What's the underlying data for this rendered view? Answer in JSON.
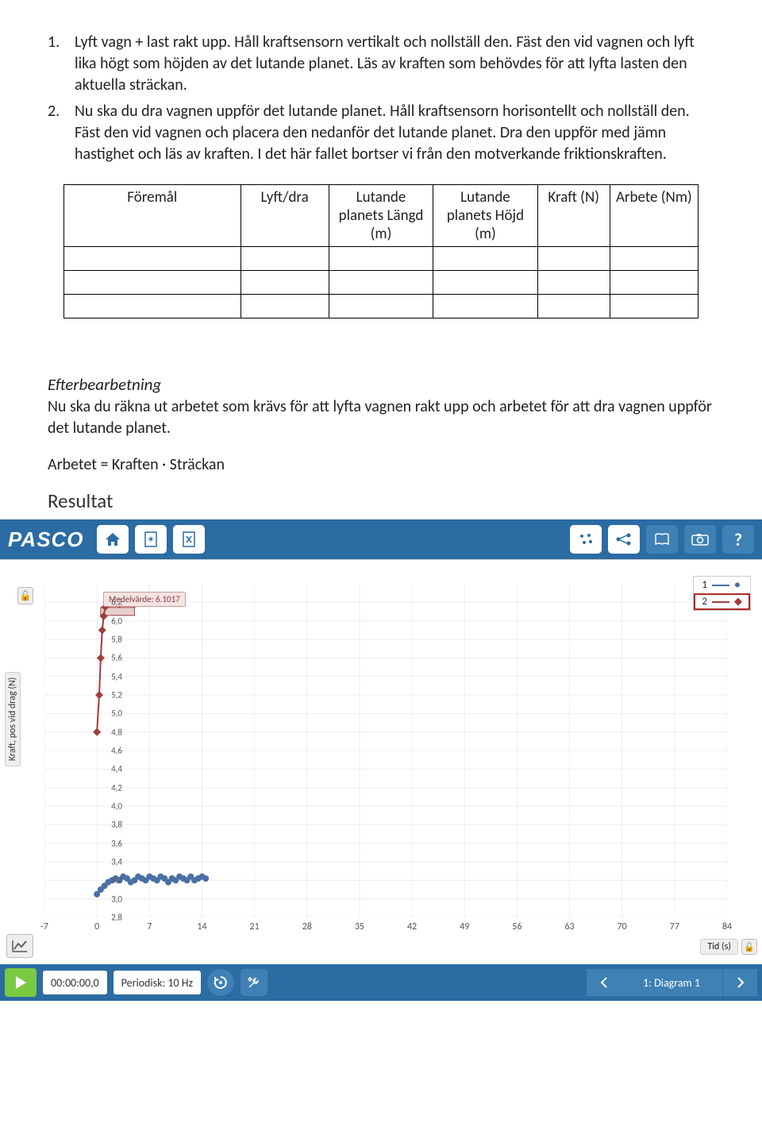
{
  "instructions": [
    {
      "num": "1.",
      "text": "Lyft vagn + last rakt upp. Håll kraftsensorn vertikalt och nollställ den. Fäst den vid vagnen och lyft lika högt som höjden av det lutande planet. Läs av kraften som behövdes för att lyfta lasten den aktuella sträckan."
    },
    {
      "num": "2.",
      "text": "Nu ska du dra vagnen uppför det lutande planet. Håll kraftsensorn horisontellt och nollställ den. Fäst den vid vagnen och placera den nedanför det lutande planet. Dra den uppför med jämn hastighet och läs av kraften. I det här fallet bortser vi från den motverkande friktionskraften."
    }
  ],
  "table": {
    "headers": [
      "Föremål",
      "Lyft/dra",
      "Lutande planets Längd (m)",
      "Lutande planets Höjd (m)",
      "Kraft (N)",
      "Arbete (Nm)"
    ],
    "rows": 3
  },
  "post": {
    "heading": "Efterbearbetning",
    "text": "Nu ska du räkna ut arbetet som krävs för att lyfta vagnen rakt upp och arbetet för att dra vagnen uppför det lutande planet.",
    "formula": "Arbetet = Kraften · Sträckan",
    "result_heading": "Resultat"
  },
  "pasco": {
    "logo": "PASCO",
    "legend": [
      "1",
      "2"
    ],
    "annotation": "Medelvärde: 6.1017",
    "ylabel": "Kraft, pos vid drag (N)",
    "xlabel": "Tid (s)",
    "yticks": [
      "6,2",
      "6,0",
      "5,8",
      "5,6",
      "5,4",
      "5,2",
      "5,0",
      "4,8",
      "4,6",
      "4,4",
      "4,2",
      "4,0",
      "3,8",
      "3,6",
      "3,4",
      "3,2",
      "3,0",
      "2,8"
    ],
    "xticks": [
      "-7",
      "0",
      "7",
      "14",
      "21",
      "28",
      "35",
      "42",
      "49",
      "56",
      "63",
      "70",
      "77",
      "84"
    ],
    "bottom": {
      "time": "00:00:00,0",
      "rate": "Periodisk: 10 Hz",
      "page": "1: Diagram 1"
    }
  },
  "chart_data": {
    "type": "scatter",
    "xlabel": "Tid (s)",
    "ylabel": "Kraft, pos vid drag (N)",
    "xlim": [
      -7,
      84
    ],
    "ylim": [
      2.8,
      6.4
    ],
    "series": [
      {
        "name": "1",
        "color": "#4a6fa5",
        "points": [
          {
            "x": 0.0,
            "y": 3.05
          },
          {
            "x": 0.5,
            "y": 3.1
          },
          {
            "x": 1.0,
            "y": 3.14
          },
          {
            "x": 1.5,
            "y": 3.18
          },
          {
            "x": 2.0,
            "y": 3.2
          },
          {
            "x": 2.5,
            "y": 3.22
          },
          {
            "x": 3.0,
            "y": 3.2
          },
          {
            "x": 3.5,
            "y": 3.24
          },
          {
            "x": 4.0,
            "y": 3.22
          },
          {
            "x": 4.5,
            "y": 3.18
          },
          {
            "x": 5.0,
            "y": 3.2
          },
          {
            "x": 5.5,
            "y": 3.24
          },
          {
            "x": 6.0,
            "y": 3.22
          },
          {
            "x": 6.5,
            "y": 3.2
          },
          {
            "x": 7.0,
            "y": 3.24
          },
          {
            "x": 7.5,
            "y": 3.22
          },
          {
            "x": 8.0,
            "y": 3.2
          },
          {
            "x": 8.5,
            "y": 3.24
          },
          {
            "x": 9.0,
            "y": 3.22
          },
          {
            "x": 9.5,
            "y": 3.18
          },
          {
            "x": 10.0,
            "y": 3.22
          },
          {
            "x": 10.5,
            "y": 3.2
          },
          {
            "x": 11.0,
            "y": 3.24
          },
          {
            "x": 11.5,
            "y": 3.22
          },
          {
            "x": 12.0,
            "y": 3.2
          },
          {
            "x": 12.5,
            "y": 3.24
          },
          {
            "x": 13.0,
            "y": 3.2
          },
          {
            "x": 13.5,
            "y": 3.22
          },
          {
            "x": 14.0,
            "y": 3.24
          },
          {
            "x": 14.5,
            "y": 3.22
          }
        ]
      },
      {
        "name": "2",
        "color": "#a23b3b",
        "mean": 6.1017,
        "points": [
          {
            "x": 0.0,
            "y": 4.8
          },
          {
            "x": 0.3,
            "y": 5.2
          },
          {
            "x": 0.5,
            "y": 5.6
          },
          {
            "x": 0.7,
            "y": 5.9
          },
          {
            "x": 0.9,
            "y": 6.05
          },
          {
            "x": 1.1,
            "y": 6.15
          },
          {
            "x": 1.3,
            "y": 6.2
          },
          {
            "x": 1.5,
            "y": 6.2
          },
          {
            "x": 2.0,
            "y": 6.22
          },
          {
            "x": 2.5,
            "y": 6.2
          },
          {
            "x": 3.0,
            "y": 6.18
          },
          {
            "x": 3.5,
            "y": 6.2
          },
          {
            "x": 4.0,
            "y": 6.22
          },
          {
            "x": 4.5,
            "y": 6.2
          },
          {
            "x": 5.0,
            "y": 6.18
          }
        ]
      }
    ]
  }
}
